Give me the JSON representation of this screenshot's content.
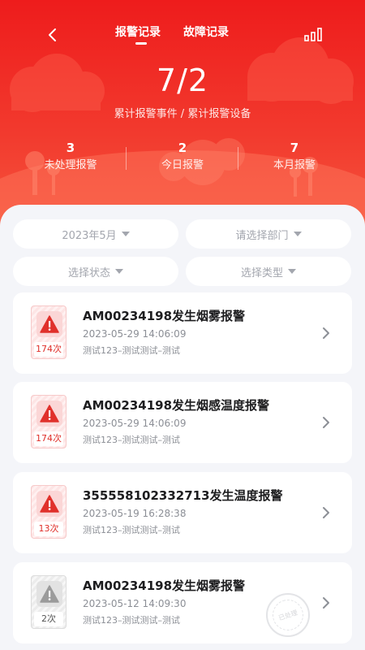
{
  "header": {
    "tabs": [
      {
        "label": "报警记录",
        "active": true
      },
      {
        "label": "故障记录",
        "active": false
      }
    ],
    "ratio": "7/2",
    "ratio_label": "累计报警事件 / 累计报警设备",
    "stats": [
      {
        "value": "3",
        "label": "未处理报警"
      },
      {
        "value": "2",
        "label": "今日报警"
      },
      {
        "value": "7",
        "label": "本月报警"
      }
    ]
  },
  "filters": {
    "month": "2023年5月",
    "department": "请选择部门",
    "status": "选择状态",
    "type": "选择类型"
  },
  "alarms": [
    {
      "title": "AM00234198发生烟雾报警",
      "time": "2023-05-29 14:06:09",
      "location": "测试123–测试测试–测试",
      "count": "174次",
      "state": "active"
    },
    {
      "title": "AM00234198发生烟感温度报警",
      "time": "2023-05-29 14:06:09",
      "location": "测试123–测试测试–测试",
      "count": "174次",
      "state": "active"
    },
    {
      "title": "355558102332713发生温度报警",
      "time": "2023-05-19 16:28:38",
      "location": "测试123–测试测试–测试",
      "count": "13次",
      "state": "active"
    },
    {
      "title": "AM00234198发生烟雾报警",
      "time": "2023-05-12 14:09:30",
      "location": "测试123–测试测试–测试",
      "count": "2次",
      "state": "handled",
      "stamp": "已处理"
    }
  ],
  "colors": {
    "primary": "#ee1c1c",
    "alarm_red": "#e0302b",
    "handled_grey": "#9b9b9b"
  },
  "icons": {
    "back": "chevron-left-icon",
    "signal": "signal-bars-icon",
    "warning": "warning-triangle-icon",
    "detail": "chevron-right-icon"
  }
}
